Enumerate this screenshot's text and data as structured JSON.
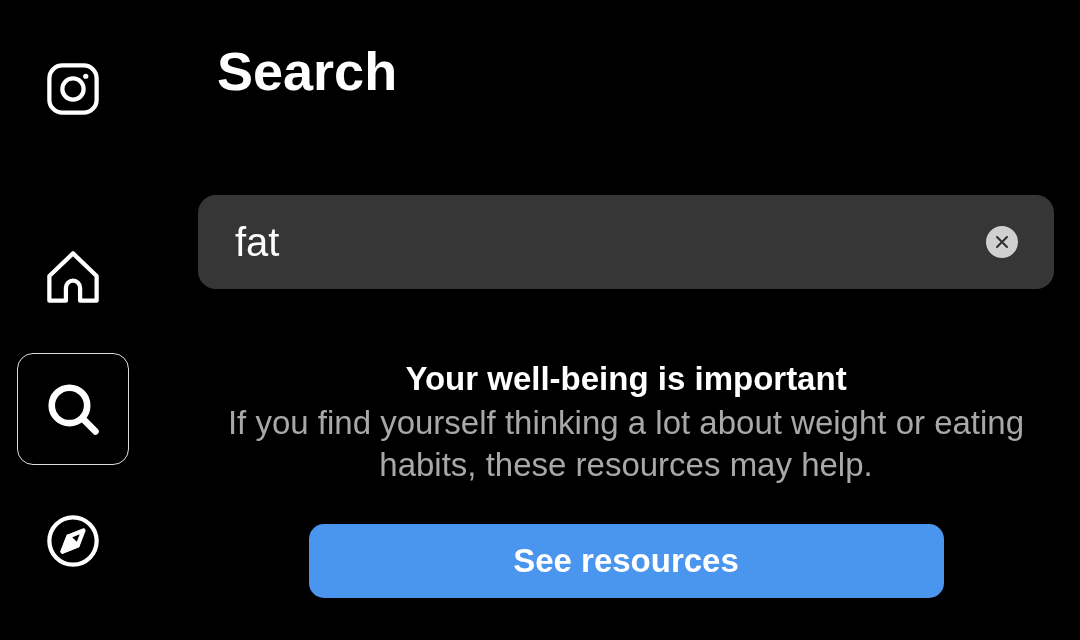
{
  "sidebar": {
    "items": [
      {
        "kind": "home",
        "selected": false
      },
      {
        "kind": "search",
        "selected": true
      },
      {
        "kind": "explore",
        "selected": false
      }
    ]
  },
  "header": {
    "title": "Search"
  },
  "search": {
    "value": "fat"
  },
  "notice": {
    "title": "Your well-being is important",
    "body": "If you find yourself thinking a lot about weight or eating habits, these resources may help.",
    "button": "See resources"
  }
}
